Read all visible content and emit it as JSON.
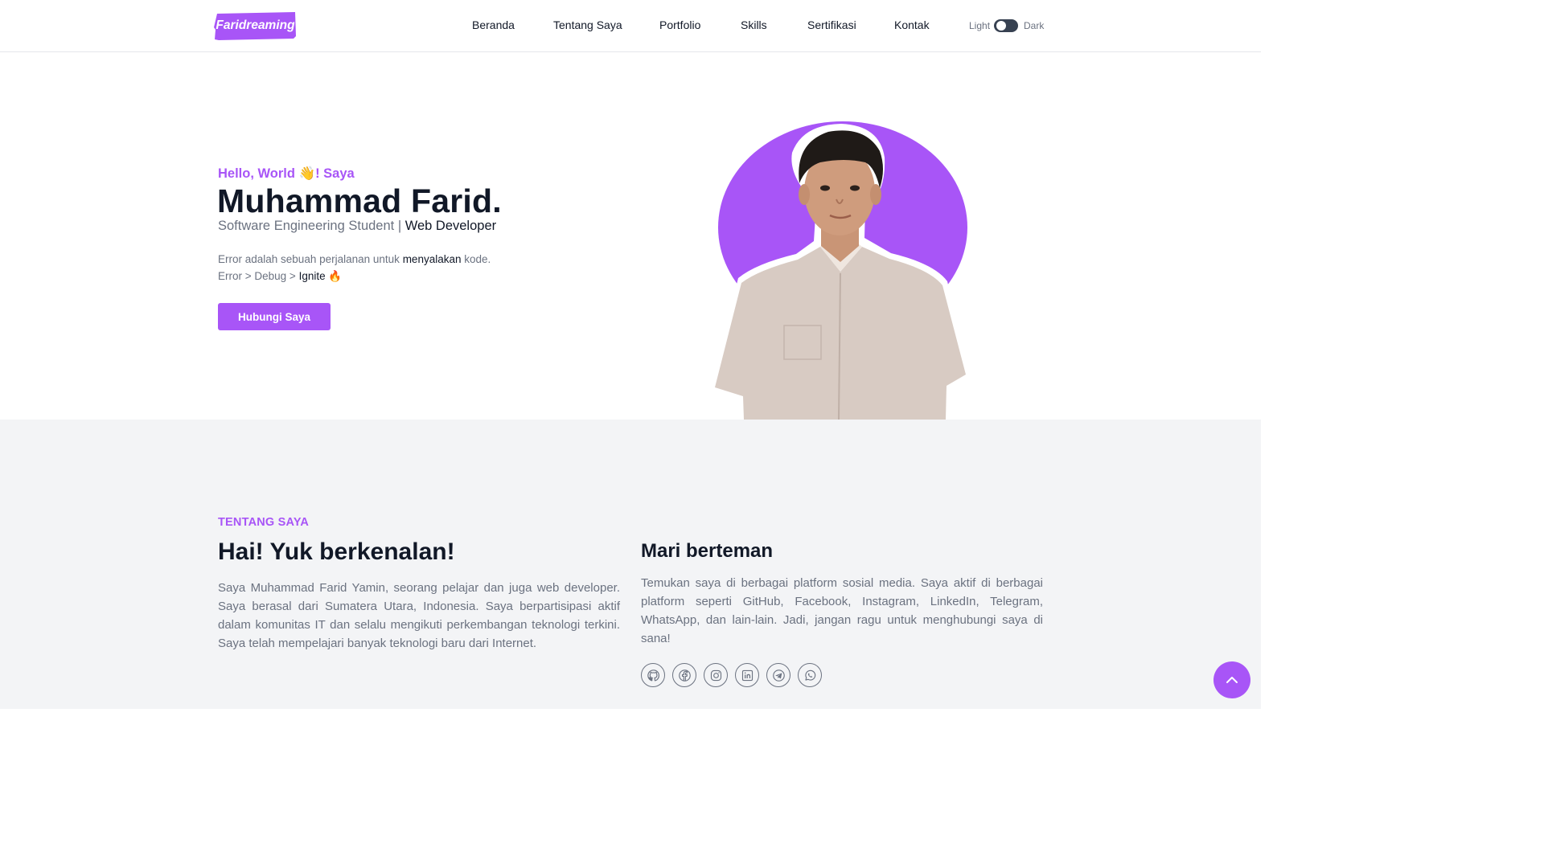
{
  "brand": {
    "logo_text": "Faridreaming",
    "accent": "#a855f7"
  },
  "nav": {
    "items": [
      {
        "label": "Beranda"
      },
      {
        "label": "Tentang Saya"
      },
      {
        "label": "Portfolio"
      },
      {
        "label": "Skills"
      },
      {
        "label": "Sertifikasi"
      },
      {
        "label": "Kontak"
      }
    ],
    "theme_light_label": "Light",
    "theme_dark_label": "Dark"
  },
  "hero": {
    "greeting": "Hello, World 👋! Saya",
    "name": "Muhammad Farid.",
    "role_prefix": "Software Engineering Student |",
    "role_highlight": "Web Developer",
    "quote_line1_start": "Error adalah sebuah perjalanan untuk",
    "quote_line1_highlight": "menyalakan",
    "quote_line1_end": "kode.",
    "quote_line2_start": "Error > Debug >",
    "quote_line2_highlight": "Ignite",
    "quote_line2_emoji": "🔥",
    "cta_label": "Hubungi Saya",
    "photo_icon": "profile-photo",
    "blob_color": "#a855f7"
  },
  "about": {
    "kicker": "TENTANG SAYA",
    "title": "Hai! Yuk berkenalan!",
    "text": "Saya Muhammad Farid Yamin, seorang pelajar dan juga web developer. Saya berasal dari Sumatera Utara, Indonesia. Saya berpartisipasi aktif dalam komunitas IT dan selalu mengikuti perkembangan teknologi terkini. Saya telah mempelajari banyak teknologi baru dari Internet.",
    "friends_title": "Mari berteman",
    "friends_text": "Temukan saya di berbagai platform sosial media. Saya aktif di berbagai platform seperti GitHub, Facebook, Instagram, LinkedIn, Telegram, WhatsApp, dan lain-lain. Jadi, jangan ragu untuk menghubungi saya di sana!",
    "socials": [
      {
        "icon": "github-icon"
      },
      {
        "icon": "facebook-icon"
      },
      {
        "icon": "instagram-icon"
      },
      {
        "icon": "linkedin-icon"
      },
      {
        "icon": "telegram-icon"
      },
      {
        "icon": "whatsapp-icon"
      }
    ]
  },
  "scroll_top": {
    "icon": "chevron-up-icon"
  }
}
